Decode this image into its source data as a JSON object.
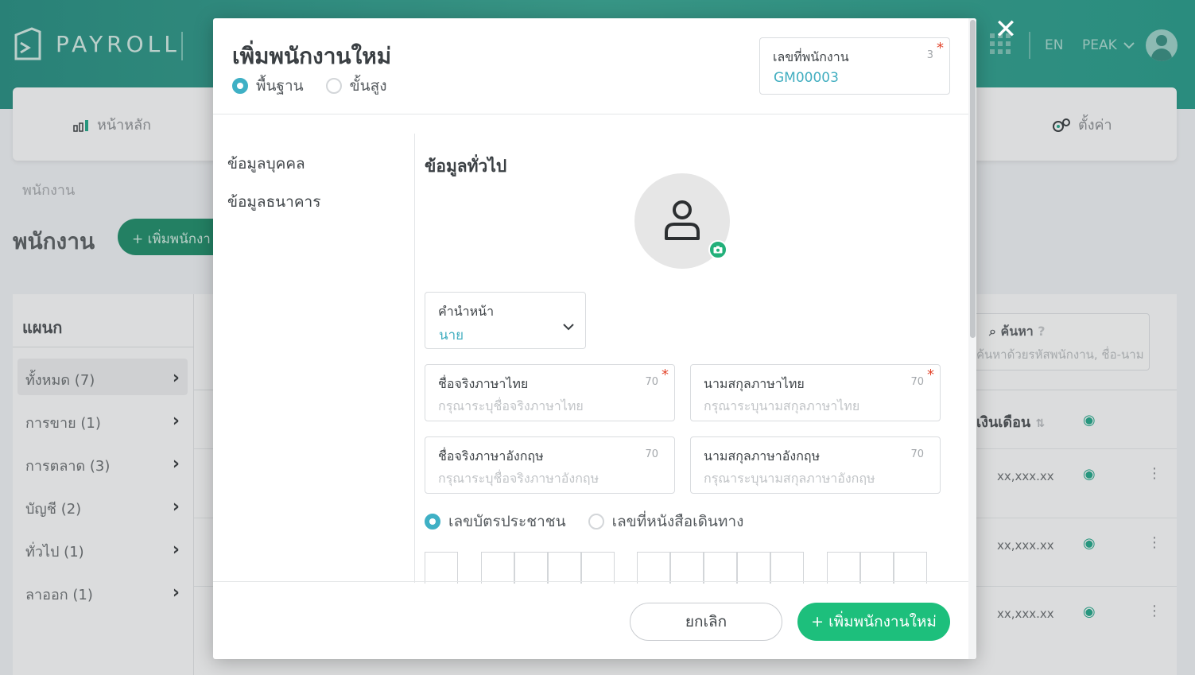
{
  "app": {
    "brand": "PAYROLL",
    "lang": "EN",
    "account": "PEAK",
    "nav": {
      "home": "หน้าหลัก",
      "settings": "ตั้งค่า"
    },
    "breadcrumb": "พนักงาน",
    "page_title": "พนักงาน",
    "add_button": "+ เพิ่มพนักงา",
    "departments": {
      "title": "แผนก",
      "items": [
        {
          "label": "ทั้งหมด (7)"
        },
        {
          "label": "การขาย (1)"
        },
        {
          "label": "การตลาด (3)"
        },
        {
          "label": "บัญชี (2)"
        },
        {
          "label": "ทั่วไป (1)"
        },
        {
          "label": "ลาออก (1)"
        }
      ]
    },
    "search": {
      "label": "ค้นหา",
      "placeholder": "ค้นหาด้วยรหัสพนักงาน, ชื่อ-นาม"
    },
    "table": {
      "salary_header": "เงินเดือน",
      "rows": [
        {
          "salary": "xx,xxx.xx"
        },
        {
          "salary": "xx,xxx.xx"
        },
        {
          "salary": "xx,xxx.xx"
        }
      ]
    }
  },
  "modal": {
    "title": "เพิ่มพนักงานใหม่",
    "mode": {
      "basic": "พื้นฐาน",
      "advanced": "ขั้นสูง",
      "selected": "basic"
    },
    "employee_no": {
      "label": "เลขที่พนักงาน",
      "count": "3",
      "value": "GM00003"
    },
    "menu": {
      "personal": "ข้อมูลบุคคล",
      "bank": "ข้อมูลธนาคาร"
    },
    "section_title": "ข้อมูลทั่วไป",
    "prefix": {
      "label": "คำนำหน้า",
      "value": "นาย"
    },
    "fields": {
      "first_th": {
        "label": "ชื่อจริงภาษาไทย",
        "count": "70",
        "placeholder": "กรุณาระบุชื่อจริงภาษาไทย"
      },
      "last_th": {
        "label": "นามสกุลภาษาไทย",
        "count": "70",
        "placeholder": "กรุณาระบุนามสกุลภาษาไทย"
      },
      "first_en": {
        "label": "ชื่อจริงภาษาอังกฤษ",
        "count": "70",
        "placeholder": "กรุณาระบุชื่อจริงภาษาอังกฤษ"
      },
      "last_en": {
        "label": "นามสกุลภาษาอังกฤษ",
        "count": "70",
        "placeholder": "กรุณาระบุนามสกุลภาษาอังกฤษ"
      }
    },
    "id_type": {
      "citizen": "เลขบัตรประชาชน",
      "passport": "เลขที่หนังสือเดินทาง",
      "selected": "citizen"
    },
    "buttons": {
      "cancel": "ยกเลิก",
      "submit": "+ เพิ่มพนักงานใหม่"
    }
  },
  "colors": {
    "accent": "#3fb0c5",
    "primary": "#1dbf7c",
    "required": "#e2452c",
    "topbar": "#2a8e82"
  }
}
